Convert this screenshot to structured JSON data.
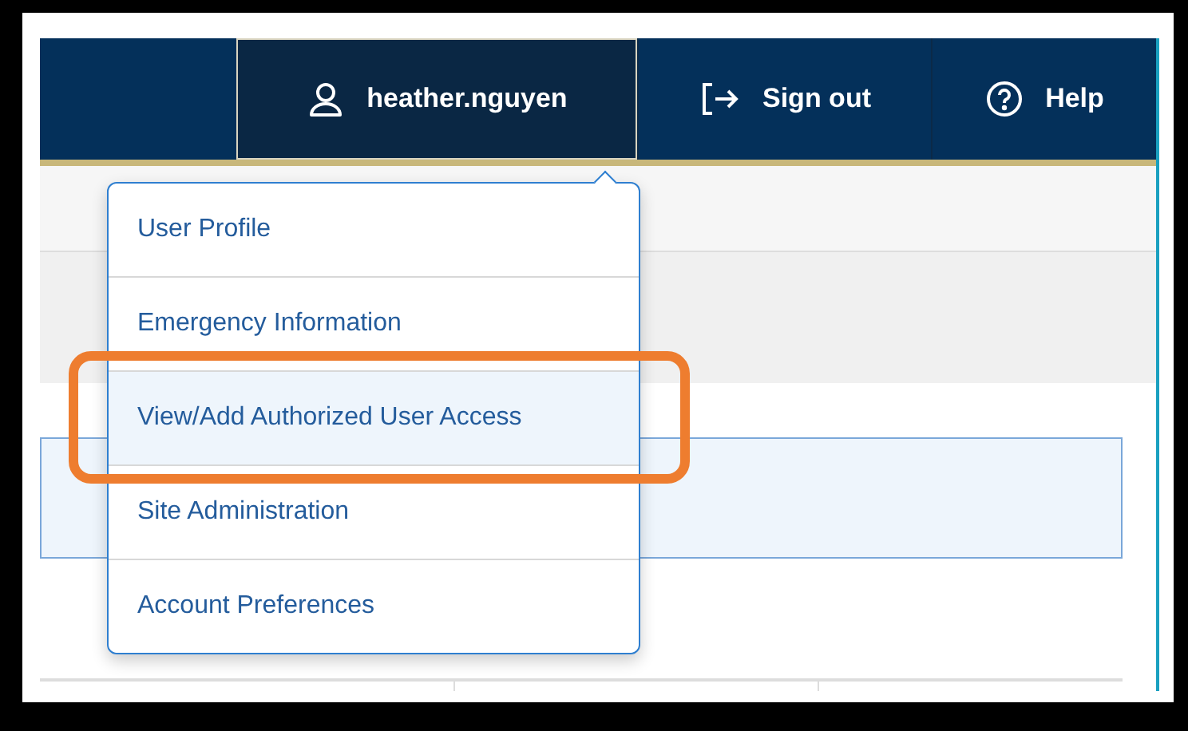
{
  "navbar": {
    "items": [
      {
        "kind": "user",
        "label": "heather.nguyen",
        "selected": true
      },
      {
        "kind": "signout",
        "label": "Sign out",
        "selected": false
      },
      {
        "kind": "help",
        "label": "Help",
        "selected": false
      }
    ]
  },
  "user_menu": {
    "items": [
      {
        "label": "User Profile",
        "selected": false,
        "annotated": false
      },
      {
        "label": "Emergency Information",
        "selected": false,
        "annotated": false
      },
      {
        "label": "View/Add Authorized User Access",
        "selected": true,
        "annotated": true
      },
      {
        "label": "Site Administration",
        "selected": false,
        "annotated": false
      },
      {
        "label": "Account Preferences",
        "selected": false,
        "annotated": false
      }
    ]
  }
}
